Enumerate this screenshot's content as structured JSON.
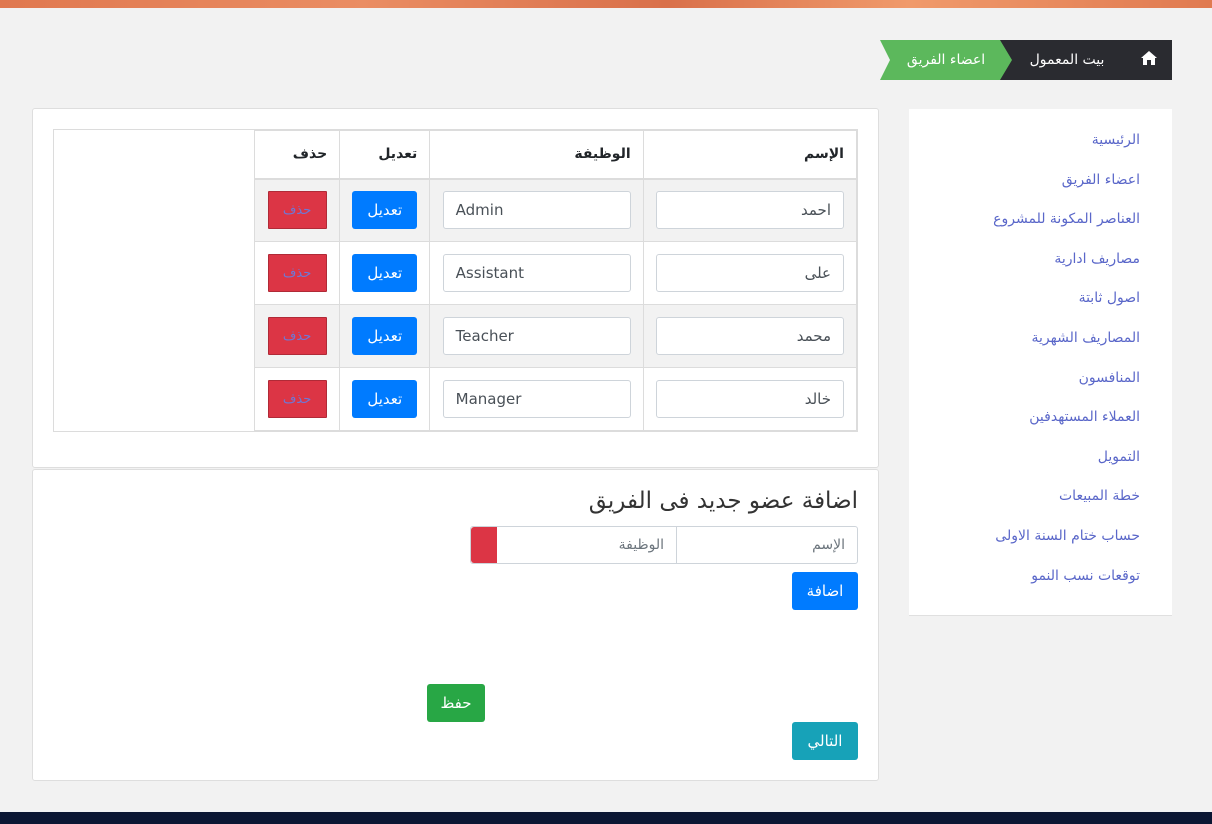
{
  "breadcrumb": {
    "home_icon": "home-icon",
    "parent": "بيت المعمول",
    "current": "اعضاء الفريق"
  },
  "sidebar": {
    "items": [
      {
        "label": "الرئيسية"
      },
      {
        "label": "اعضاء الفريق"
      },
      {
        "label": "العناصر المكونة للمشروع"
      },
      {
        "label": "مصاريف ادارية"
      },
      {
        "label": "اصول ثابتة"
      },
      {
        "label": "المصاريف الشهرية"
      },
      {
        "label": "المنافسون"
      },
      {
        "label": "العملاء المستهدفين"
      },
      {
        "label": "التمويل"
      },
      {
        "label": "خطة المبيعات"
      },
      {
        "label": "حساب ختام السنة الاولى"
      },
      {
        "label": "توقعات نسب النمو"
      }
    ]
  },
  "table": {
    "headers": {
      "name": "الإسم",
      "job": "الوظيفة",
      "edit": "تعديل",
      "delete": "حذف"
    },
    "rows": [
      {
        "name": "احمد",
        "job": "Admin",
        "edit": "تعديل",
        "delete": "حذف"
      },
      {
        "name": "على",
        "job": "Assistant",
        "edit": "تعديل",
        "delete": "حذف"
      },
      {
        "name": "محمد",
        "job": "Teacher",
        "edit": "تعديل",
        "delete": "حذف"
      },
      {
        "name": "خالد",
        "job": "Manager",
        "edit": "تعديل",
        "delete": "حذف"
      }
    ]
  },
  "form": {
    "title": "اضافة عضو جديد فى الفريق",
    "name_placeholder": "الإسم",
    "job_placeholder": "الوظيفة",
    "add_label": "اضافة",
    "save_label": "حفظ",
    "next_label": "التالي"
  },
  "colors": {
    "primary": "#007bff",
    "danger": "#dc3545",
    "success": "#28a745",
    "info": "#17a2b8",
    "breadcrumb_active": "#5cb85c",
    "breadcrumb_dark": "#2a2b30",
    "sidebar_link": "#5a67c9"
  }
}
